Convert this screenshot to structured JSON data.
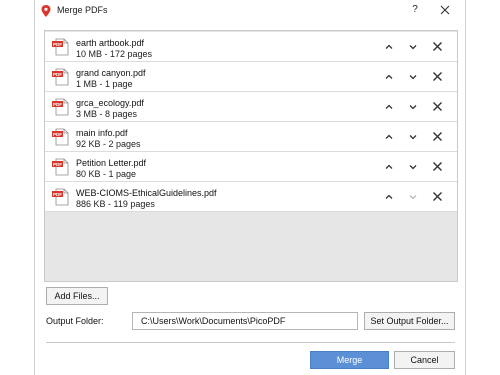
{
  "window": {
    "title": "Merge PDFs",
    "help_label": "?"
  },
  "files": [
    {
      "name": "earth artbook.pdf",
      "meta": "10 MB - 172 pages",
      "up_enabled": true,
      "down_enabled": true
    },
    {
      "name": "grand canyon.pdf",
      "meta": "1 MB - 1 page",
      "up_enabled": true,
      "down_enabled": true
    },
    {
      "name": "grca_ecology.pdf",
      "meta": "3 MB - 8 pages",
      "up_enabled": true,
      "down_enabled": true
    },
    {
      "name": "main info.pdf",
      "meta": "92 KB - 2 pages",
      "up_enabled": true,
      "down_enabled": true
    },
    {
      "name": "Petition Letter.pdf",
      "meta": "80 KB - 1 page",
      "up_enabled": true,
      "down_enabled": true
    },
    {
      "name": "WEB-CIOMS-EthicalGuidelines.pdf",
      "meta": "886 KB - 119 pages",
      "up_enabled": true,
      "down_enabled": false
    }
  ],
  "buttons": {
    "add_files": "Add Files...",
    "set_output_folder": "Set Output Folder...",
    "merge": "Merge",
    "cancel": "Cancel"
  },
  "output": {
    "label": "Output Folder:",
    "path": "C:\\Users\\Work\\Documents\\PicoPDF"
  },
  "colors": {
    "merge_button": "#5b8fd6",
    "pdf_badge": "#d9352b",
    "app_icon": "#d9352b"
  },
  "icons": {
    "app": "map-pin-icon",
    "file": "pdf-file-icon",
    "up": "chevron-up-icon",
    "down": "chevron-down-icon",
    "remove": "close-icon"
  }
}
